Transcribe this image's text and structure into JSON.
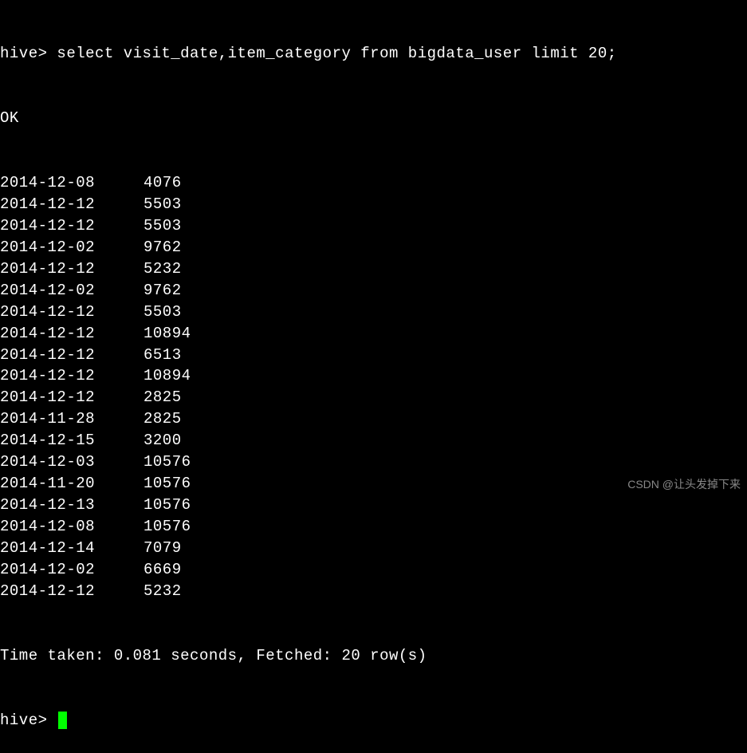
{
  "prompt_prefix": "hive> ",
  "query": "select visit_date,item_category from bigdata_user limit 20;",
  "ok": "OK",
  "rows": [
    {
      "visit_date": "2014-12-08",
      "item_category": "4076"
    },
    {
      "visit_date": "2014-12-12",
      "item_category": "5503"
    },
    {
      "visit_date": "2014-12-12",
      "item_category": "5503"
    },
    {
      "visit_date": "2014-12-02",
      "item_category": "9762"
    },
    {
      "visit_date": "2014-12-12",
      "item_category": "5232"
    },
    {
      "visit_date": "2014-12-02",
      "item_category": "9762"
    },
    {
      "visit_date": "2014-12-12",
      "item_category": "5503"
    },
    {
      "visit_date": "2014-12-12",
      "item_category": "10894"
    },
    {
      "visit_date": "2014-12-12",
      "item_category": "6513"
    },
    {
      "visit_date": "2014-12-12",
      "item_category": "10894"
    },
    {
      "visit_date": "2014-12-12",
      "item_category": "2825"
    },
    {
      "visit_date": "2014-11-28",
      "item_category": "2825"
    },
    {
      "visit_date": "2014-12-15",
      "item_category": "3200"
    },
    {
      "visit_date": "2014-12-03",
      "item_category": "10576"
    },
    {
      "visit_date": "2014-11-20",
      "item_category": "10576"
    },
    {
      "visit_date": "2014-12-13",
      "item_category": "10576"
    },
    {
      "visit_date": "2014-12-08",
      "item_category": "10576"
    },
    {
      "visit_date": "2014-12-14",
      "item_category": "7079"
    },
    {
      "visit_date": "2014-12-02",
      "item_category": "6669"
    },
    {
      "visit_date": "2014-12-12",
      "item_category": "5232"
    }
  ],
  "footer": "Time taken: 0.081 seconds, Fetched: 20 row(s)",
  "watermark": "CSDN @让头发掉下来"
}
